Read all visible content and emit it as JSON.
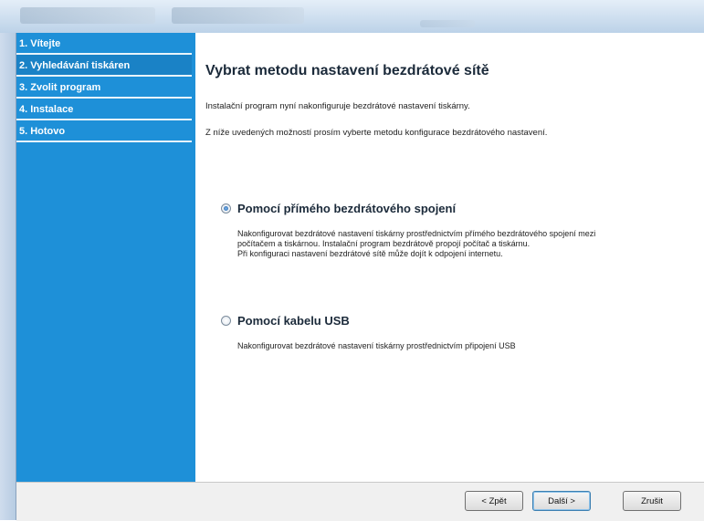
{
  "sidebar": {
    "items": [
      {
        "label": "1. Vítejte"
      },
      {
        "label": "2. Vyhledávání tiskáren"
      },
      {
        "label": "3. Zvolit program"
      },
      {
        "label": "4. Instalace"
      },
      {
        "label": "5. Hotovo"
      }
    ]
  },
  "main": {
    "title": "Vybrat metodu nastavení bezdrátové sítě",
    "intro_1": "Instalační program nyní nakonfiguruje bezdrátové nastavení tiskárny.",
    "intro_2": "Z níže uvedených možností prosím vyberte metodu konfigurace bezdrátového nastavení.",
    "options": [
      {
        "label": "Pomocí přímého bezdrátového spojení",
        "selected": true,
        "desc_lines": [
          "Nakonfigurovat bezdrátové nastavení tiskárny prostřednictvím přímého bezdrátového spojení mezi",
          "počítačem a tiskárnou. Instalační program bezdrátově propojí počítač a tiskárnu.",
          "Při konfiguraci nastavení bezdrátové sítě může dojít k odpojení internetu."
        ]
      },
      {
        "label": "Pomocí kabelu USB",
        "selected": false,
        "desc_lines": [
          "Nakonfigurovat bezdrátové nastavení tiskárny prostřednictvím připojení USB"
        ]
      }
    ]
  },
  "buttons": {
    "back": "< Zpět",
    "next": "Další >",
    "cancel": "Zrušit"
  },
  "colors": {
    "sidebar": "#1e90d8",
    "sidebar_active": "#1a82c6",
    "window_frame": "#bcd2e8"
  }
}
